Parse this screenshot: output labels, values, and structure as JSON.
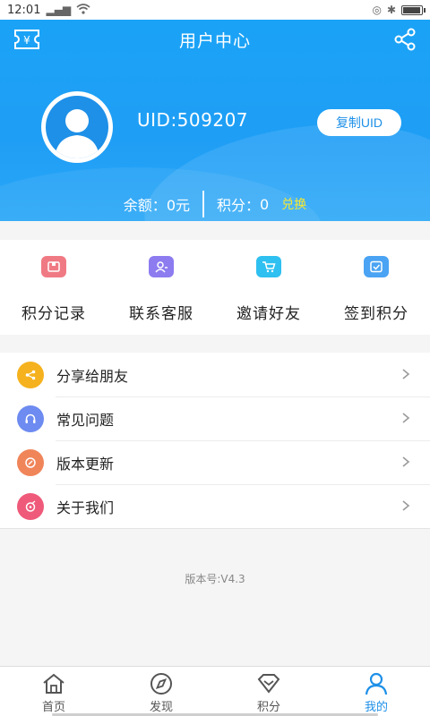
{
  "status_bar": {
    "time": "12:01",
    "signal_icon": "signal-icon",
    "wifi_icon": "wifi-icon",
    "bluetooth_icon": "bluetooth-icon",
    "battery_icon": "battery-icon"
  },
  "header": {
    "title": "用户中心",
    "left_icon": "ticket-icon",
    "right_icon": "share-icon",
    "uid_text": "UID:509207",
    "copy_button": "复制UID",
    "balance_label": "余额：",
    "balance_value": "0元",
    "points_label": "积分：",
    "points_value": "0",
    "exchange_label": "兑换"
  },
  "quick_actions": [
    {
      "label": "积分记录",
      "icon": "record-icon",
      "color": "#f07a84"
    },
    {
      "label": "联系客服",
      "icon": "service-icon",
      "color": "#8c7cf0"
    },
    {
      "label": "邀请好友",
      "icon": "cart-icon",
      "color": "#2ec0f0"
    },
    {
      "label": "签到积分",
      "icon": "checkin-icon",
      "color": "#4aa3f3"
    }
  ],
  "menu": [
    {
      "label": "分享给朋友",
      "icon": "share-icon",
      "color": "#f5b21e"
    },
    {
      "label": "常见问题",
      "icon": "headset-icon",
      "color": "#6d8bf0"
    },
    {
      "label": "版本更新",
      "icon": "update-icon",
      "color": "#f0855a"
    },
    {
      "label": "关于我们",
      "icon": "about-icon",
      "color": "#ef5a7a"
    }
  ],
  "version_text": "版本号:V4.3",
  "tabs": [
    {
      "label": "首页",
      "icon": "home-icon",
      "active": false
    },
    {
      "label": "发现",
      "icon": "compass-icon",
      "active": false
    },
    {
      "label": "积分",
      "icon": "diamond-icon",
      "active": false
    },
    {
      "label": "我的",
      "icon": "user-icon",
      "active": true
    }
  ],
  "colors": {
    "primary": "#1e9ef5",
    "accent_yellow": "#f6e930"
  }
}
